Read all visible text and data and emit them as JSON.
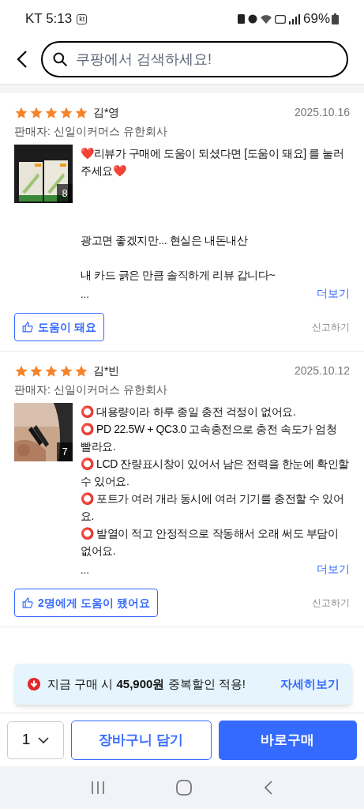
{
  "status_bar": {
    "carrier": "KT",
    "time": "5:13",
    "carrier_badge": "kt",
    "battery": "69%"
  },
  "search": {
    "placeholder": "쿠팡에서 검색하세요!"
  },
  "reviews": [
    {
      "stars": 5,
      "author": "김*영",
      "date": "2025.10.16",
      "seller": "판매자: 신일이커머스 유한회사",
      "photo_count": "8",
      "body": "❤️리뷰가 구매에 도움이 되셨다면 [도움이 돼요] 를 눌러주세요❤️\n\n\n\n광고면 좋겠지만... 현실은 내돈내산\n\n내 카드 긁은 만큼 솔직하게 리뷰 갑니다~\n",
      "ellipsis": "...",
      "more": "더보기",
      "helpful": "도움이 돼요",
      "report": "신고하기"
    },
    {
      "stars": 5,
      "author": "김*빈",
      "date": "2025.10.12",
      "seller": "판매자: 신일이커머스 유한회사",
      "photo_count": "7",
      "body": "⭕ 대용량이라 하루 종일 충전 걱정이 없어요.\n⭕ PD 22.5W + QC3.0 고속충전으로 충전 속도가 엄청 빨라요.\n⭕ LCD 잔량표시창이 있어서 남은 전력을 한눈에 확인할 수 있어요.\n⭕ 포트가 여러 개라 동시에 여러 기기를 충전할 수 있어요.\n⭕ 발열이 적고 안정적으로 작동해서 오래 써도 부담이 없어요.",
      "ellipsis": "...",
      "more": "더보기",
      "helpful": "2명에게 도움이 됐어요",
      "report": "신고하기"
    }
  ],
  "banner": {
    "text": "지금 구매 시 **45,900원** 중복할인 적용!",
    "link": "자세히보기"
  },
  "bottom_bar": {
    "quantity": "1",
    "cart": "장바구니 담기",
    "buy": "바로구매"
  }
}
